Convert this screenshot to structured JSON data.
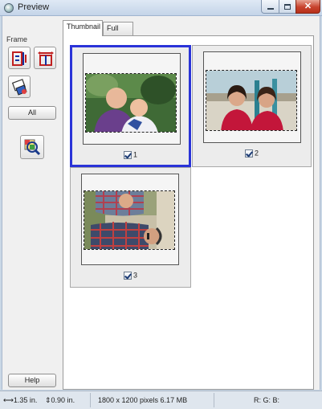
{
  "window": {
    "title": "Preview",
    "minimize_icon": "minimize-icon",
    "maximize_icon": "maximize-icon",
    "close_icon": "close-icon"
  },
  "left_panel": {
    "frame_label": "Frame",
    "tools": [
      {
        "name": "select-frame-icon"
      },
      {
        "name": "adjust-frame-icon"
      },
      {
        "name": "auto-exposure-icon"
      },
      {
        "name": "zoom-icon"
      }
    ],
    "all_label": "All",
    "help_label": "Help"
  },
  "tabs": [
    {
      "label": "Thumbnail",
      "active": true
    },
    {
      "label": "Full Size",
      "active": false
    }
  ],
  "thumbnails": [
    {
      "number": "1",
      "checked": true,
      "selected": true,
      "orientation": "landscape",
      "subject": "two boys"
    },
    {
      "number": "2",
      "checked": true,
      "selected": false,
      "orientation": "landscape",
      "subject": "two women"
    },
    {
      "number": "3",
      "checked": true,
      "selected": false,
      "orientation": "rotated",
      "subject": "two men"
    }
  ],
  "status": {
    "width_value": "1.35 in.",
    "height_value": "0.90 in.",
    "pixels_info": "1800 x 1200 pixels 6.17 MB",
    "rgb_label": "R: G: B:"
  },
  "colors": {
    "selection_border": "#2a33d8",
    "close_button": "#c7432d"
  }
}
